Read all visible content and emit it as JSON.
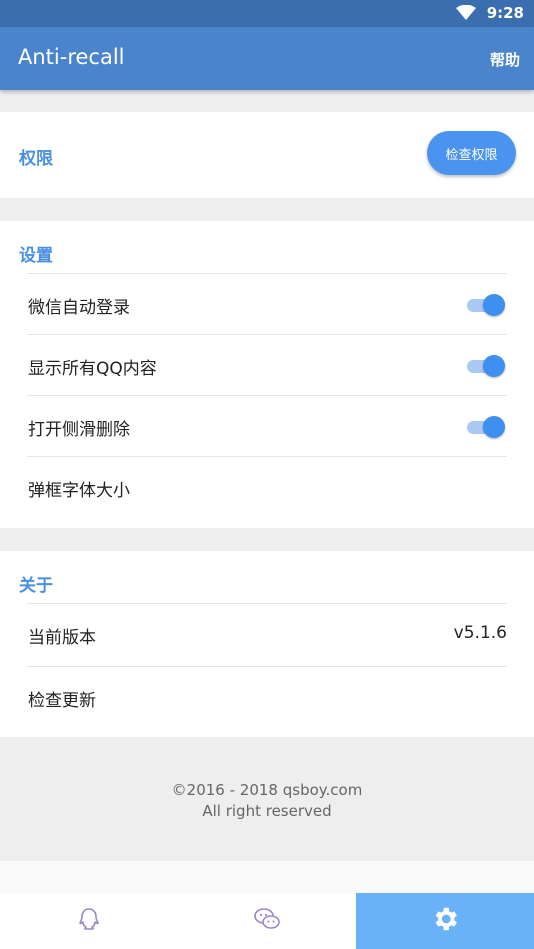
{
  "status_bar": {
    "time": "9:28",
    "wifi_icon": "wifi-icon"
  },
  "app_bar": {
    "title": "Anti-recall",
    "help_label": "帮助"
  },
  "permission": {
    "label": "权限",
    "check_button": "检查权限"
  },
  "settings": {
    "title": "设置",
    "items": [
      {
        "label": "微信自动登录",
        "toggle": true
      },
      {
        "label": "显示所有QQ内容",
        "toggle": true
      },
      {
        "label": "打开侧滑删除",
        "toggle": true
      },
      {
        "label": "弹框字体大小"
      }
    ]
  },
  "about": {
    "title": "关于",
    "version_label": "当前版本",
    "version_value": "v5.1.6",
    "update_label": "检查更新"
  },
  "footer": {
    "copyright": "©2016 - 2018 qsboy.com",
    "rights": "All right reserved"
  },
  "bottom_nav": {
    "items": [
      {
        "icon": "qq-icon",
        "active": false
      },
      {
        "icon": "wechat-icon",
        "active": false
      },
      {
        "icon": "gear-icon",
        "active": true
      }
    ]
  },
  "colors": {
    "primary": "#4a84cd",
    "accent": "#4a90e2",
    "nav_active": "#6ab2f7"
  }
}
